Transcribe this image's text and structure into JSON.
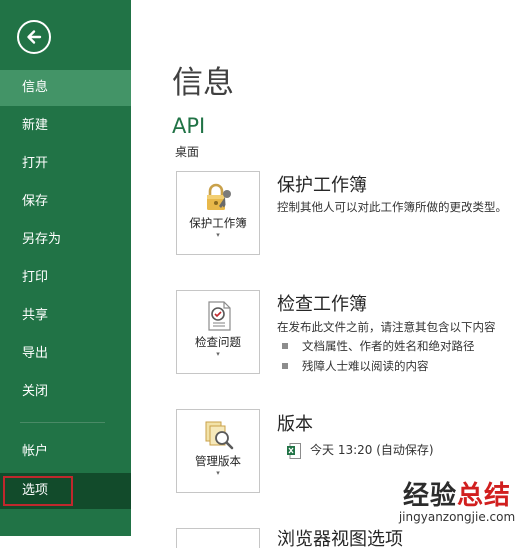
{
  "sidebar": {
    "back_icon": "back-arrow-icon",
    "items": [
      {
        "label": "信息"
      },
      {
        "label": "新建"
      },
      {
        "label": "打开"
      },
      {
        "label": "保存"
      },
      {
        "label": "另存为"
      },
      {
        "label": "打印"
      },
      {
        "label": "共享"
      },
      {
        "label": "导出"
      },
      {
        "label": "关闭"
      },
      {
        "label": "帐户"
      },
      {
        "label": "选项"
      }
    ],
    "selected": "信息",
    "colors": {
      "background": "#217346",
      "selected": "#439467",
      "highlight_box": "#c0282d"
    }
  },
  "main": {
    "title": "信息",
    "doc_name": "API",
    "doc_path": "桌面",
    "sections": [
      {
        "tile_label": "保护工作簿",
        "tile_icon": "lock-key-icon",
        "title": "保护工作簿",
        "description": "控制其他人可以对此工作簿所做的更改类型。"
      },
      {
        "tile_label": "检查问题",
        "tile_icon": "inspect-document-icon",
        "title": "检查工作簿",
        "description": "在发布此文件之前，请注意其包含以下内容",
        "bullets": [
          "文档属性、作者的姓名和绝对路径",
          "残障人士难以阅读的内容"
        ]
      },
      {
        "tile_label": "管理版本",
        "tile_icon": "manage-versions-icon",
        "title": "版本",
        "version_entry": "今天 13:20 (自动保存)"
      }
    ],
    "partial_title": "浏览器视图选项"
  },
  "watermark": {
    "brand_part1": "经验",
    "brand_part2": "总结",
    "url": "jingyanzongjie.com"
  }
}
